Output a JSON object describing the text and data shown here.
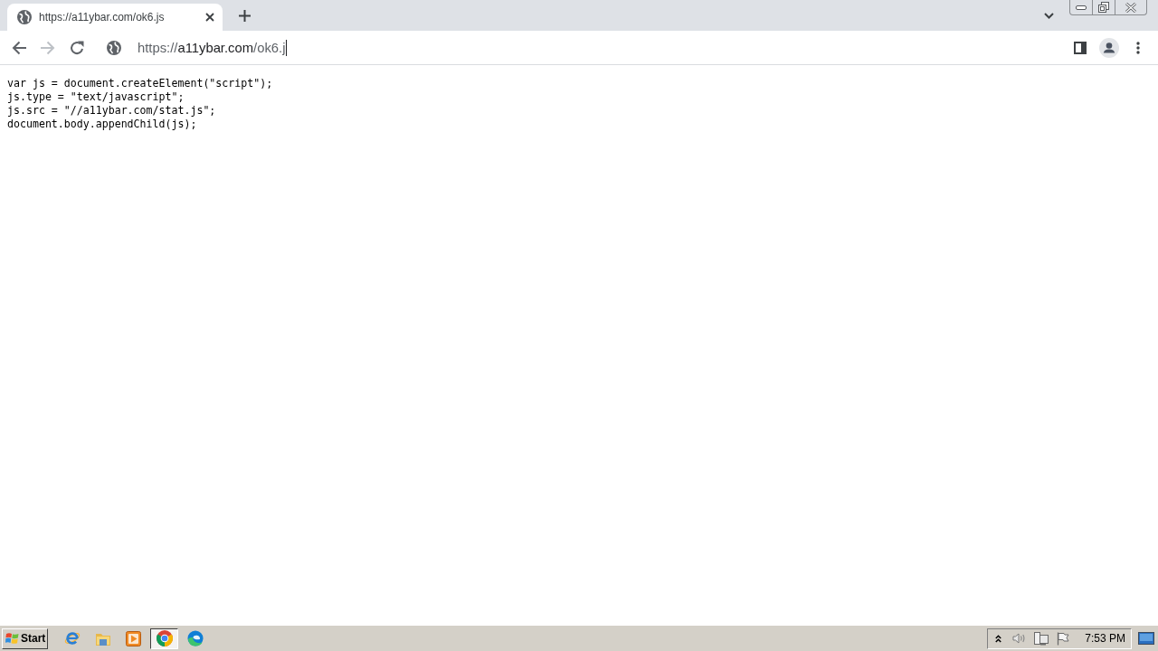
{
  "browser": {
    "tabs": [
      {
        "title": "https://a11ybar.com/ok6.js",
        "selected": true
      }
    ],
    "nav_buttons": [
      {
        "kind": "back",
        "disabled": false
      },
      {
        "kind": "forward",
        "disabled": true
      },
      {
        "kind": "reload",
        "disabled": false
      }
    ],
    "address_bar": {
      "scheme": "https://",
      "host": "a11ybar.com",
      "path": "/ok6.j",
      "focused": true
    }
  },
  "page": {
    "code_lines": [
      "var js = document.createElement(\"script\");",
      "js.type = \"text/javascript\";",
      "js.src = \"//a11ybar.com/stat.js\";",
      "document.body.appendChild(js);"
    ]
  },
  "taskbar": {
    "start_label": "Start",
    "apps": [
      {
        "kind": "browser-e",
        "selected": false
      },
      {
        "kind": "folder",
        "selected": false
      },
      {
        "kind": "player",
        "selected": false
      },
      {
        "kind": "browser-ring",
        "selected": true
      },
      {
        "kind": "browser-wave",
        "selected": false
      }
    ],
    "clock": "7:53 PM"
  }
}
